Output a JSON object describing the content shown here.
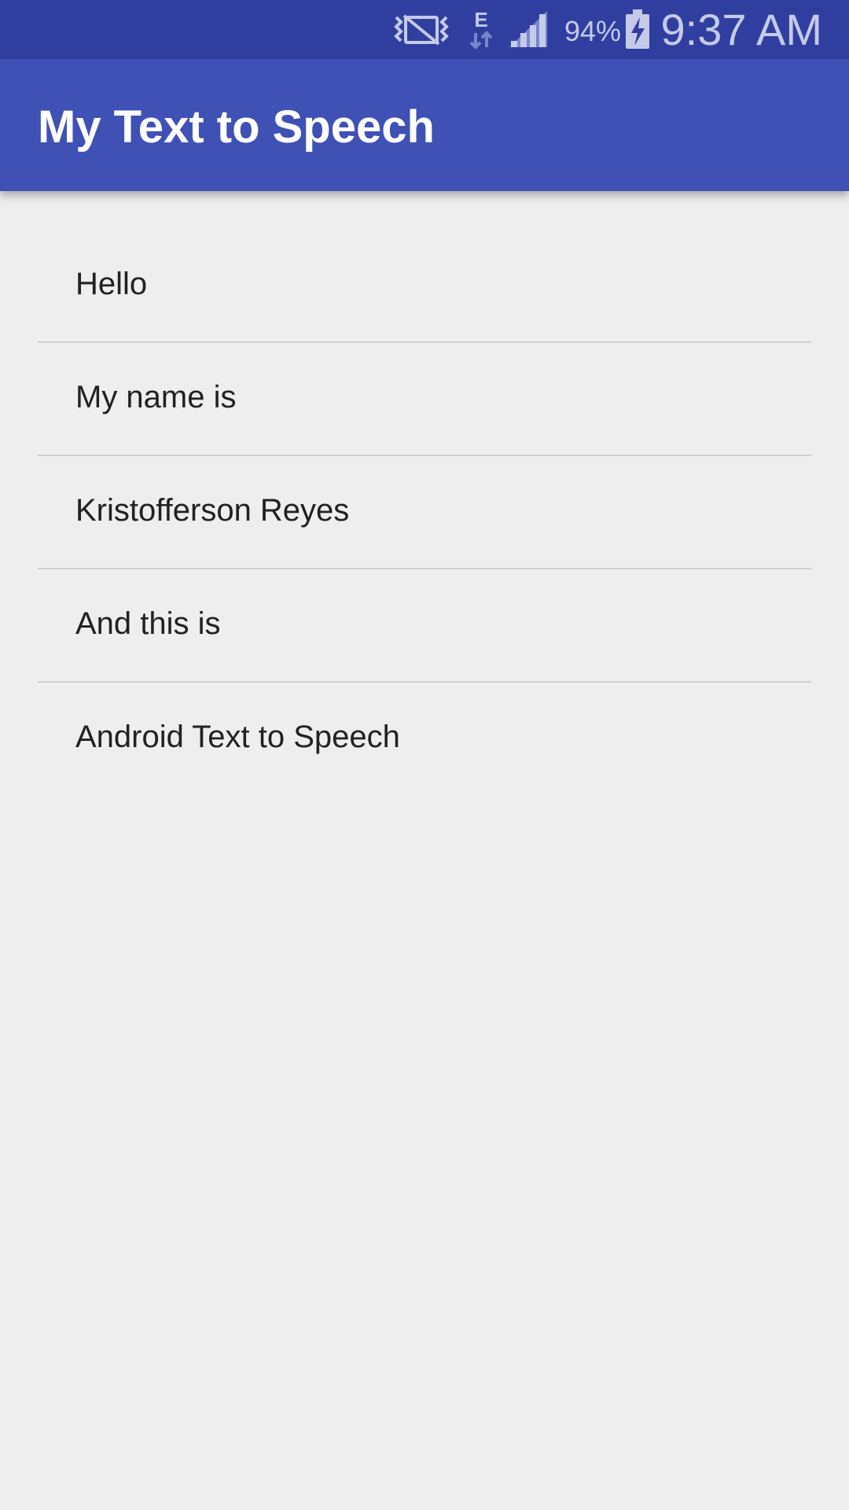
{
  "status_bar": {
    "icons": [
      "vibrate-mute-icon",
      "edge-data-icon",
      "signal-icon",
      "battery-charging-icon"
    ],
    "network_type": "E",
    "battery_percent": "94%",
    "time": "9:37 AM",
    "colors": {
      "background": "#303f9f",
      "foreground": "#c5cae9"
    }
  },
  "app_bar": {
    "title": "My Text to Speech",
    "color": "#3f51b5"
  },
  "list": {
    "items": [
      {
        "label": "Hello"
      },
      {
        "label": "My name is"
      },
      {
        "label": "Kristofferson Reyes"
      },
      {
        "label": "And this is"
      },
      {
        "label": "Android Text to Speech"
      }
    ]
  }
}
